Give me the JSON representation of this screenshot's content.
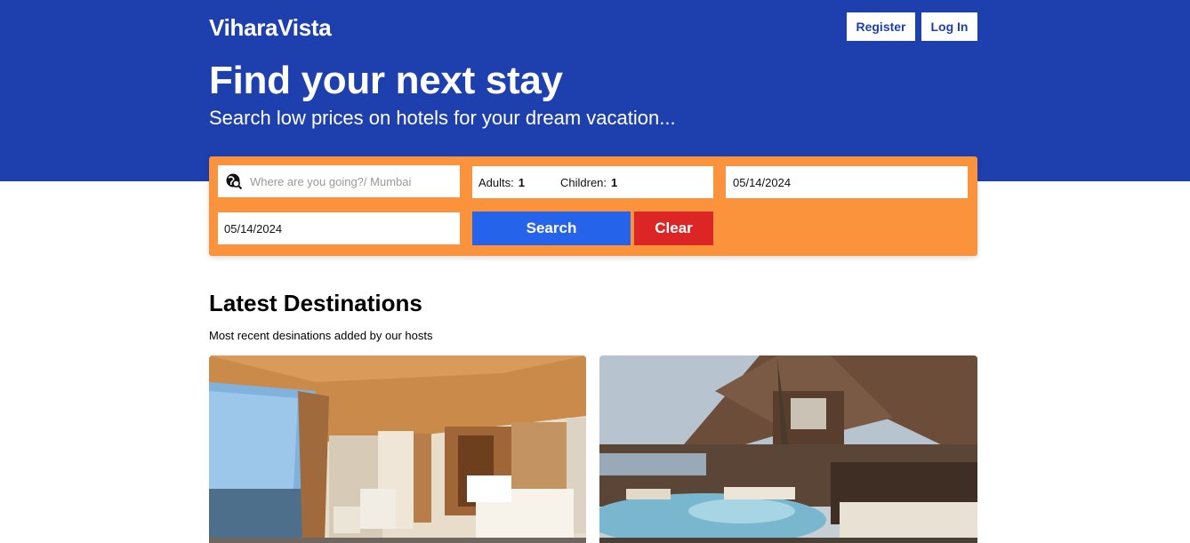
{
  "header": {
    "brand": "ViharaVista",
    "register_label": "Register",
    "login_label": "Log In"
  },
  "hero": {
    "title": "Find your next stay",
    "subtitle": "Search low prices on hotels for your dream vacation..."
  },
  "search": {
    "destination_placeholder": "Where are you going?/ Mumbai",
    "adults_label": "Adults:",
    "adults_value": "1",
    "children_label": "Children:",
    "children_value": "1",
    "check_in": "05/14/2024",
    "check_out": "05/14/2024",
    "search_label": "Search",
    "clear_label": "Clear"
  },
  "latest": {
    "title": "Latest Destinations",
    "subtitle": "Most recent desinations added by our hosts"
  },
  "colors": {
    "hero_bg": "#1e40af",
    "panel_bg": "#fb923c",
    "search_btn": "#2563eb",
    "clear_btn": "#dc2626"
  },
  "icons": {
    "destination": "map-search-icon"
  }
}
